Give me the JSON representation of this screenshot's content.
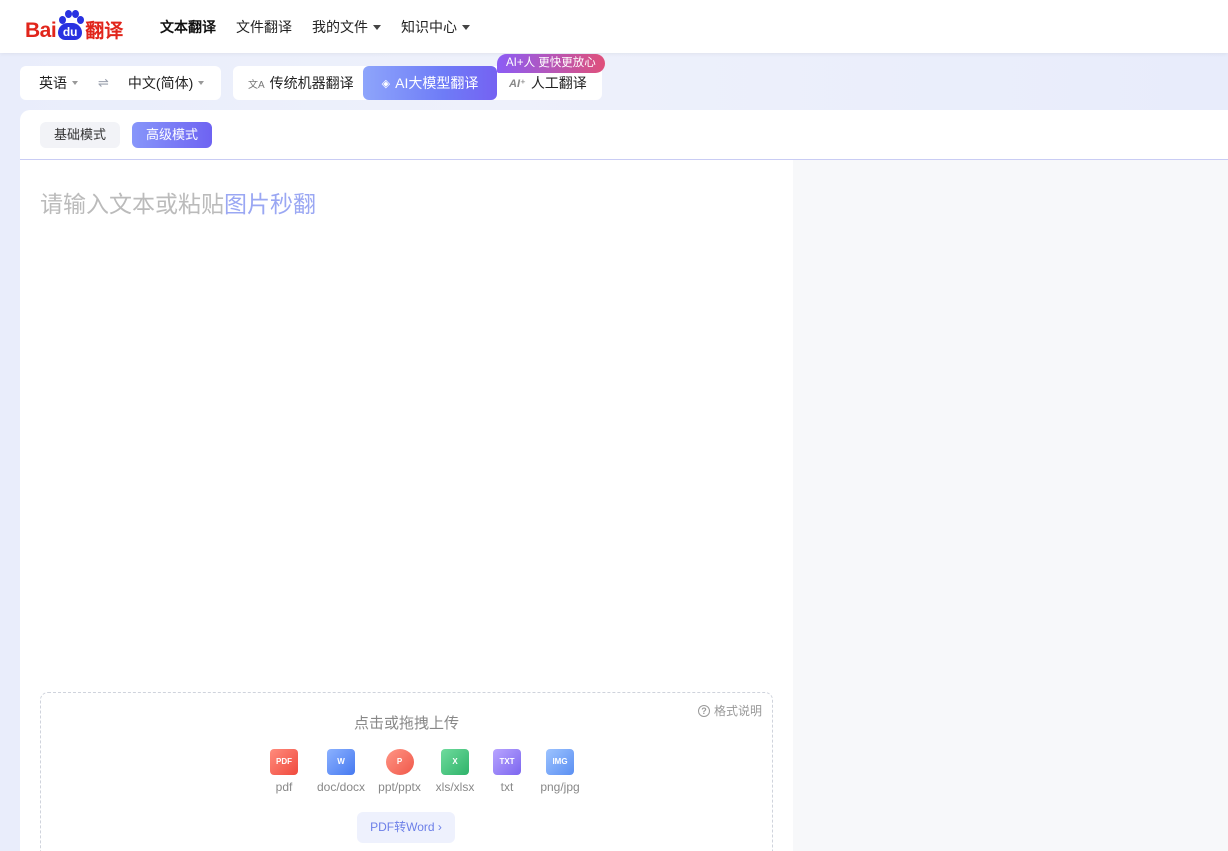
{
  "header": {
    "logo": {
      "bai": "Bai",
      "du": "du",
      "fanyi": "翻译"
    },
    "nav": [
      {
        "label": "文本翻译",
        "active": true,
        "dropdown": false
      },
      {
        "label": "文件翻译",
        "active": false,
        "dropdown": false
      },
      {
        "label": "我的文件",
        "active": false,
        "dropdown": true
      },
      {
        "label": "知识中心",
        "active": false,
        "dropdown": true
      }
    ]
  },
  "language": {
    "source": "英语",
    "swap_icon": "⇌",
    "target": "中文(简体)"
  },
  "modes": {
    "traditional": "传统机器翻译",
    "ai": "AI大模型翻译",
    "human": "人工翻译",
    "promo_badge": "AI+人 更快更放心"
  },
  "subtabs": {
    "basic": "基础模式",
    "advanced": "高级模式"
  },
  "input": {
    "placeholder_text": "请输入文本或粘贴",
    "placeholder_link": "图片秒翻"
  },
  "upload": {
    "format_help": "格式说明",
    "title": "点击或拖拽上传",
    "types": [
      {
        "label": "pdf",
        "icon": "pdf-icon"
      },
      {
        "label": "doc/docx",
        "icon": "word-icon"
      },
      {
        "label": "ppt/pptx",
        "icon": "powerpoint-icon"
      },
      {
        "label": "xls/xlsx",
        "icon": "excel-icon"
      },
      {
        "label": "txt",
        "icon": "txt-icon"
      },
      {
        "label": "png/jpg",
        "icon": "image-icon"
      }
    ],
    "pdf_to_word": "PDF转Word"
  },
  "colors": {
    "brand_red": "#e1251b",
    "brand_blue": "#2932e1",
    "accent": "#6e7cf7"
  }
}
